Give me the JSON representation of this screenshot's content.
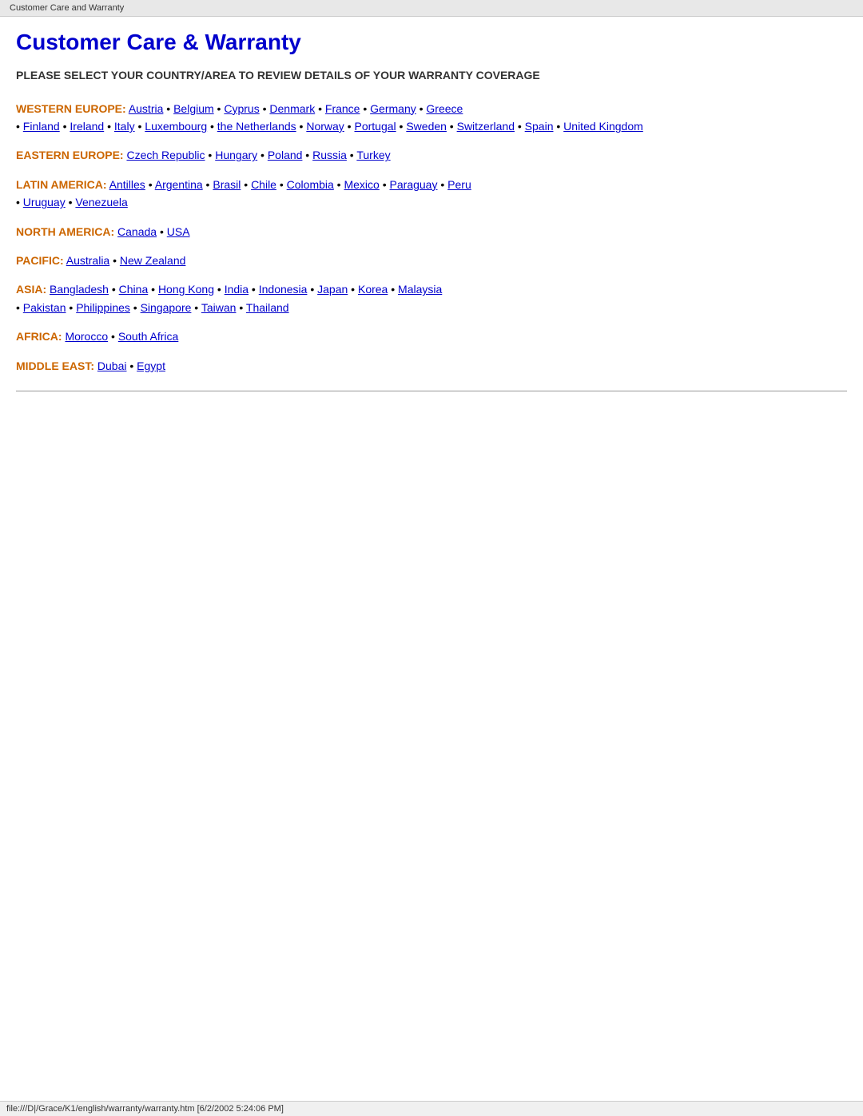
{
  "browser_tab": {
    "label": "Customer Care and Warranty"
  },
  "header": {
    "title": "Customer Care & Warranty",
    "subtitle": "PLEASE SELECT YOUR COUNTRY/AREA TO REVIEW DETAILS OF YOUR WARRANTY COVERAGE"
  },
  "regions": [
    {
      "id": "western-europe",
      "label": "WESTERN EUROPE:",
      "countries": [
        "Austria",
        "Belgium",
        "Cyprus",
        "Denmark",
        "France",
        "Germany",
        "Greece",
        "Finland",
        "Ireland",
        "Italy",
        "Luxembourg",
        "the Netherlands",
        "Norway",
        "Portugal",
        "Sweden",
        "Switzerland",
        "Spain",
        "United Kingdom"
      ]
    },
    {
      "id": "eastern-europe",
      "label": "EASTERN EUROPE:",
      "countries": [
        "Czech Republic",
        "Hungary",
        "Poland",
        "Russia",
        "Turkey"
      ]
    },
    {
      "id": "latin-america",
      "label": "LATIN AMERICA:",
      "countries": [
        "Antilles",
        "Argentina",
        "Brasil",
        "Chile",
        "Colombia",
        "Mexico",
        "Paraguay",
        "Peru",
        "Uruguay",
        "Venezuela"
      ]
    },
    {
      "id": "north-america",
      "label": "NORTH AMERICA:",
      "countries": [
        "Canada",
        "USA"
      ]
    },
    {
      "id": "pacific",
      "label": "PACIFIC:",
      "countries": [
        "Australia",
        "New Zealand"
      ]
    },
    {
      "id": "asia",
      "label": "ASIA:",
      "countries": [
        "Bangladesh",
        "China",
        "Hong Kong",
        "India",
        "Indonesia",
        "Japan",
        "Korea",
        "Malaysia",
        "Pakistan",
        "Philippines",
        "Singapore",
        "Taiwan",
        "Thailand"
      ]
    },
    {
      "id": "africa",
      "label": "AFRICA:",
      "countries": [
        "Morocco",
        "South Africa"
      ]
    },
    {
      "id": "middle-east",
      "label": "MIDDLE EAST:",
      "countries": [
        "Dubai",
        "Egypt"
      ]
    }
  ],
  "status_bar": {
    "text": "file:///D|/Grace/K1/english/warranty/warranty.htm [6/2/2002 5:24:06 PM]"
  }
}
